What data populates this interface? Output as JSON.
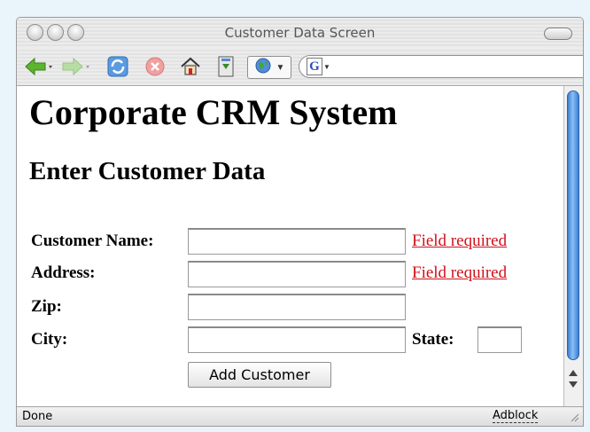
{
  "window": {
    "title": "Customer Data Screen"
  },
  "toolbar": {
    "icons": [
      "back-arrow-icon",
      "forward-arrow-icon",
      "reload-icon",
      "stop-icon",
      "home-icon",
      "bookmark-icon",
      "globe-icon",
      "google-search-icon"
    ],
    "search_engine_letter": "G"
  },
  "page": {
    "heading": "Corporate CRM System",
    "subheading": "Enter Customer Data",
    "form": {
      "customer_name_label": "Customer Name:",
      "customer_name_value": "",
      "customer_name_error": "Field required",
      "address_label": "Address:",
      "address_value": "",
      "address_error": "Field required",
      "zip_label": "Zip:",
      "zip_value": "",
      "city_label": "City:",
      "city_value": "",
      "state_label": "State:",
      "state_value": "",
      "submit_label": "Add Customer"
    }
  },
  "status": {
    "text": "Done",
    "adblock_label": "Adblock"
  },
  "colors": {
    "error": "#d0101a",
    "scroll_thumb": "#5aa0e8"
  }
}
